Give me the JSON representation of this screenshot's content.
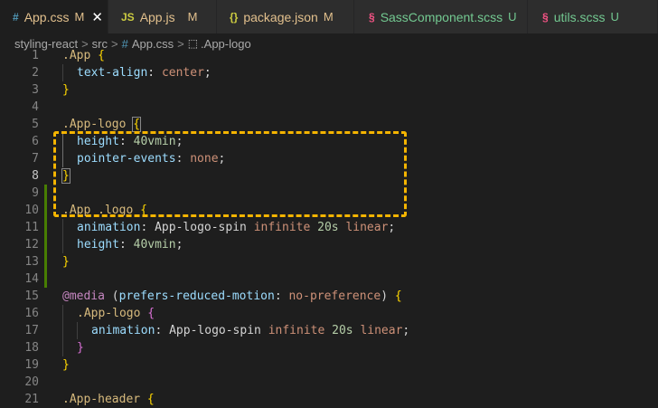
{
  "tabs": [
    {
      "icon": "#",
      "label": "App.css",
      "status": "M",
      "active": true,
      "close": "✕"
    },
    {
      "icon": "JS",
      "label": "App.js",
      "status": "M"
    },
    {
      "icon": "{}",
      "label": "package.json",
      "status": "M"
    },
    {
      "icon": "§",
      "label": "SassComponent.scss",
      "status": "U"
    },
    {
      "icon": "§",
      "label": "utils.scss",
      "status": "U"
    }
  ],
  "breadcrumb": {
    "root": "styling-react",
    "folder": "src",
    "file": "App.css",
    "symbol": ".App-logo",
    "separator": ">"
  },
  "colors": {
    "highlight": "#f4b400",
    "modified": "#e2c08d",
    "untracked": "#73c991"
  },
  "editor": {
    "current_line": "8",
    "lines": [
      {
        "n": "1",
        "t": [
          ".App {"
        ]
      },
      {
        "n": "2",
        "t": [
          "text-align",
          ": ",
          "center",
          ";"
        ]
      },
      {
        "n": "3",
        "t": [
          "}"
        ]
      },
      {
        "n": "4",
        "t": []
      },
      {
        "n": "5",
        "t": [
          ".App-logo",
          " ",
          "{"
        ]
      },
      {
        "n": "6",
        "t": [
          "height",
          ": ",
          "40vmin",
          ";"
        ]
      },
      {
        "n": "7",
        "t": [
          "pointer-events",
          ": ",
          "none",
          ";"
        ]
      },
      {
        "n": "8",
        "t": [
          "}"
        ]
      },
      {
        "n": "9",
        "t": []
      },
      {
        "n": "10",
        "t": [
          ".App .logo",
          " ",
          "{"
        ]
      },
      {
        "n": "11",
        "t": [
          "animation",
          ": ",
          "App-logo-spin",
          " ",
          "infinite",
          " ",
          "20s",
          " ",
          "linear",
          ";"
        ]
      },
      {
        "n": "12",
        "t": [
          "height",
          ": ",
          "40vmin",
          ";"
        ]
      },
      {
        "n": "13",
        "t": [
          "}"
        ]
      },
      {
        "n": "14",
        "t": []
      },
      {
        "n": "15",
        "t": [
          "@media",
          " (",
          "prefers-reduced-motion",
          ": ",
          "no-preference",
          ") ",
          "{"
        ]
      },
      {
        "n": "16",
        "t": [
          ".App-logo",
          " ",
          "{"
        ]
      },
      {
        "n": "17",
        "t": [
          "animation",
          ": ",
          "App-logo-spin",
          " ",
          "infinite",
          " ",
          "20s",
          " ",
          "linear",
          ";"
        ]
      },
      {
        "n": "18",
        "t": [
          "}"
        ]
      },
      {
        "n": "19",
        "t": [
          "}"
        ]
      },
      {
        "n": "20",
        "t": []
      },
      {
        "n": "21",
        "t": [
          ".App-header",
          " ",
          "{"
        ]
      }
    ]
  }
}
